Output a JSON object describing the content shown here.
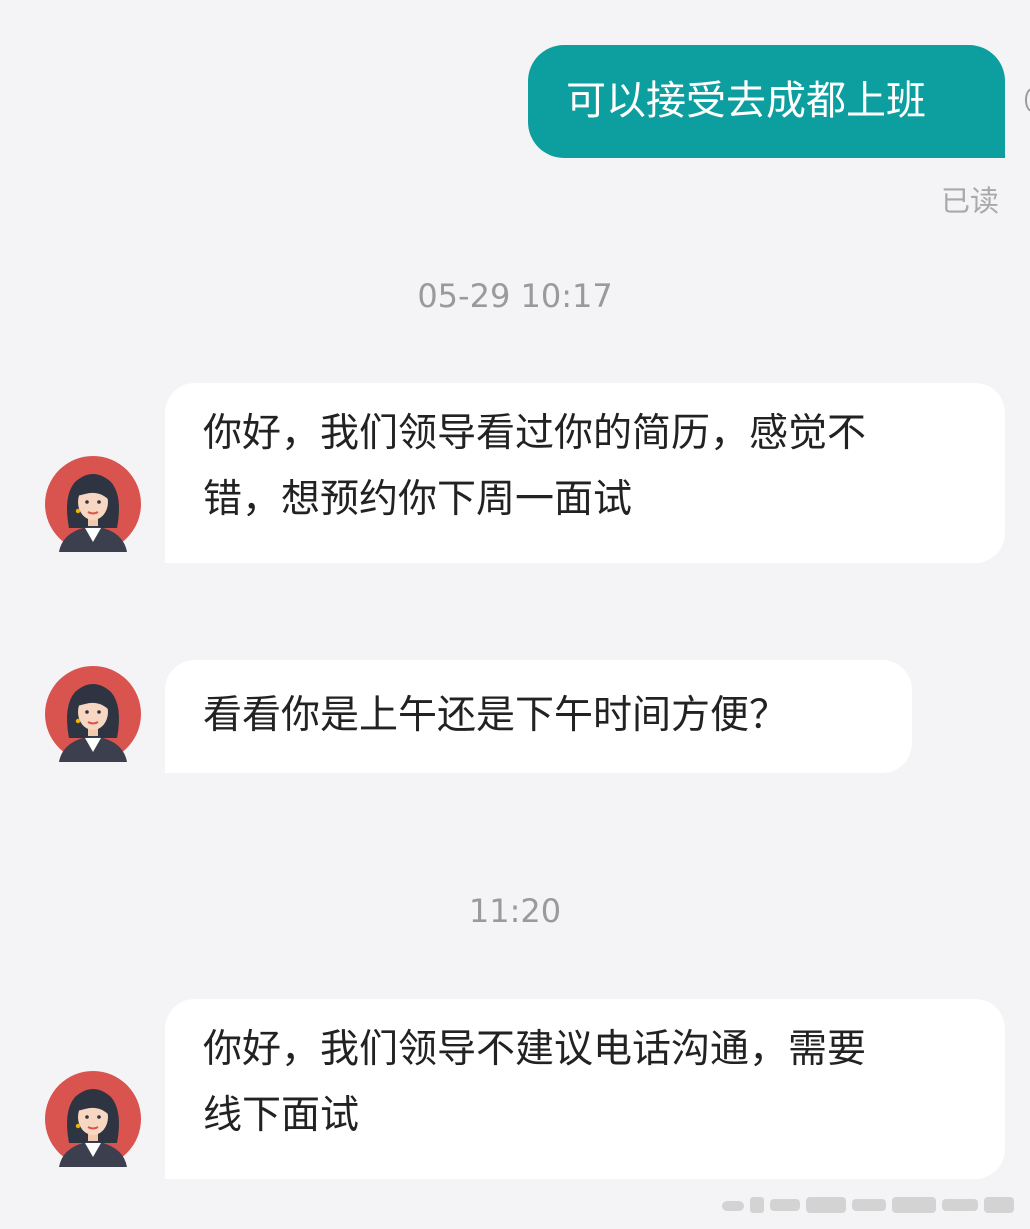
{
  "messages": {
    "outgoing_1": {
      "text": "可以接受去成都上班",
      "status": "已读"
    },
    "timestamp_1": "05-29 10:17",
    "incoming_1": {
      "line1": "你好，我们领导看过你的简历，感觉不",
      "line2": "错，想预约你下周一面试"
    },
    "incoming_2": {
      "text": "看看你是上午还是下午时间方便？"
    },
    "timestamp_2": "11:20",
    "incoming_3": {
      "line1": "你好，我们领导不建议电话沟通，需要",
      "line2": "线下面试"
    }
  },
  "colors": {
    "background": "#f4f4f6",
    "outgoing_bubble": "#0d9e9f",
    "incoming_bubble": "#ffffff",
    "avatar_ring": "#d9534f"
  },
  "icons": {
    "avatar": "recruiter-avatar-icon"
  }
}
